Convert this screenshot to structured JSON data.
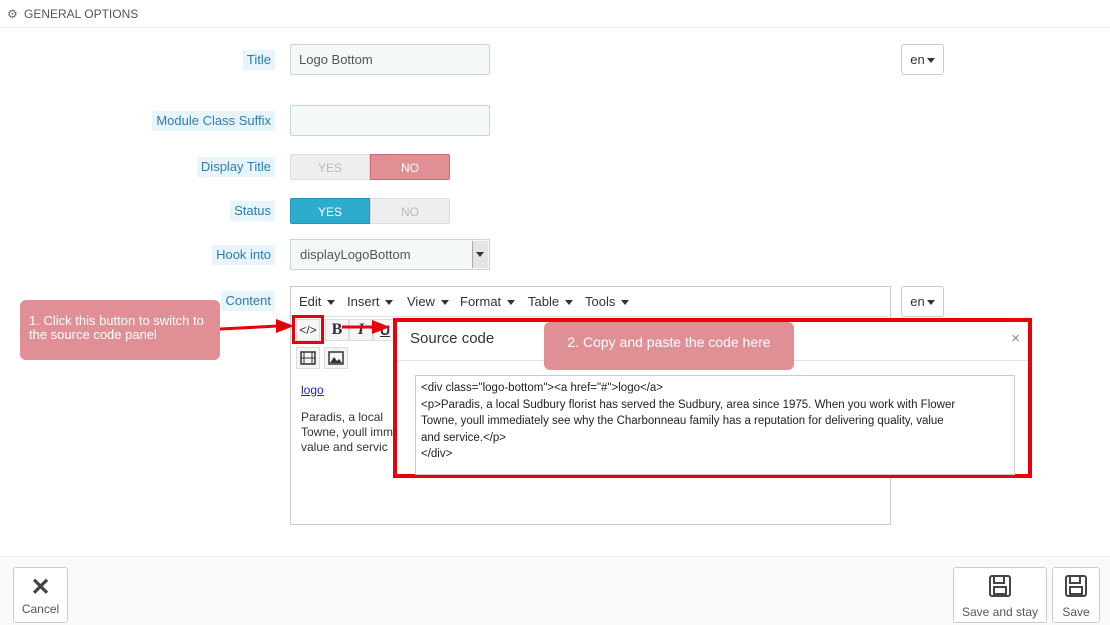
{
  "header": {
    "title": "GENERAL OPTIONS",
    "icon": "gears-icon"
  },
  "form": {
    "title": {
      "label": "Title",
      "value": "Logo Bottom",
      "lang": "en"
    },
    "suffix": {
      "label": "Module Class Suffix",
      "value": ""
    },
    "display_title": {
      "label": "Display Title",
      "yes": "YES",
      "no": "NO",
      "selected": "NO"
    },
    "status": {
      "label": "Status",
      "yes": "YES",
      "no": "NO",
      "selected": "YES"
    },
    "hook": {
      "label": "Hook into",
      "value": "displayLogoBottom"
    },
    "content": {
      "label": "Content",
      "lang": "en",
      "menus": [
        "Edit",
        "Insert",
        "View",
        "Format",
        "Table",
        "Tools"
      ],
      "toolbar": {
        "source": "</>",
        "bold": "B",
        "italic": "I",
        "underline": "U"
      },
      "body": {
        "link": "logo",
        "lines": [
          "Paradis, a local",
          "Towne, youll imm",
          "value and servic"
        ]
      }
    }
  },
  "modal": {
    "title": "Source code",
    "close": "×",
    "code_lines": [
      "<div class=\"logo-bottom\"><a href=\"#\">logo</a>",
      "<p>Paradis, a local Sudbury florist has served the Sudbury, area since 1975. When you work with Flower",
      "Towne, youll immediately see why the Charbonneau family has a reputation for delivering quality, value",
      "and service.</p>",
      "</div>"
    ]
  },
  "callouts": {
    "one": "1. Click this button to switch to the source code panel",
    "two": "2. Copy and paste the code here"
  },
  "footer": {
    "cancel": "Cancel",
    "save_stay": "Save and stay",
    "save": "Save"
  },
  "colors": {
    "accent_red": "#e8000b",
    "callout": "#e08f95",
    "yes_blue": "#2eacce"
  }
}
